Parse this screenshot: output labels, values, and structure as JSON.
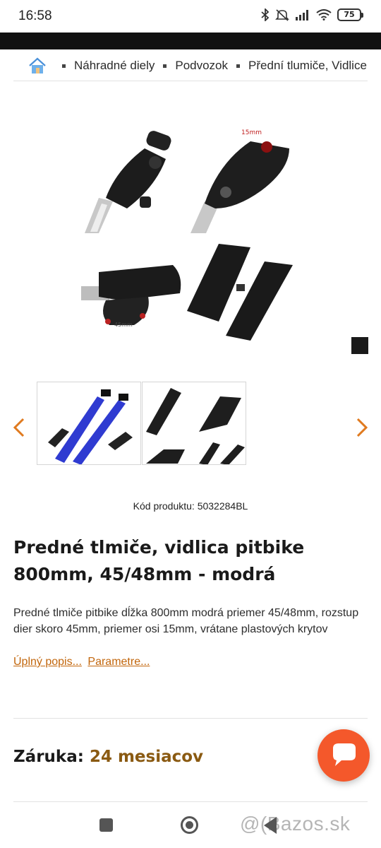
{
  "status_bar": {
    "time": "16:58",
    "battery": "75",
    "icons": [
      "bluetooth-icon",
      "mute-icon",
      "signal-icon",
      "wifi-icon",
      "battery-icon"
    ]
  },
  "breadcrumb": {
    "home_icon": "home-icon",
    "items": [
      "Náhradné diely",
      "Podvozok",
      "Přední tlumiče, Vidlice"
    ]
  },
  "gallery": {
    "main_image_labels": [
      "15mm",
      "45mm"
    ],
    "thumbnails": [
      "thumbnail-blue-forks",
      "thumbnail-fork-parts"
    ],
    "prev_icon": "chevron-left-icon",
    "next_icon": "chevron-right-icon"
  },
  "product": {
    "code": "Kód produktu: 5032284BL",
    "title": "Predné tlmiče, vidlica pitbike 800mm, 45/48mm - modrá",
    "description": "Predné tlmiče pitbike dĺžka 800mm modrá priemer 45/48mm, rozstup dier skoro 45mm, priemer osi 15mm, vrátane plastových krytov",
    "link_full_desc": "Úplný popis...",
    "link_params": "Parametre..."
  },
  "warranty": {
    "label": "Záruka:",
    "value": "24 mesiacov"
  },
  "colors": {
    "accent_link": "#c2660c",
    "warranty_value": "#8a5a12",
    "chat_button": "#f4582b"
  },
  "watermark": "@(Bazos.sk"
}
